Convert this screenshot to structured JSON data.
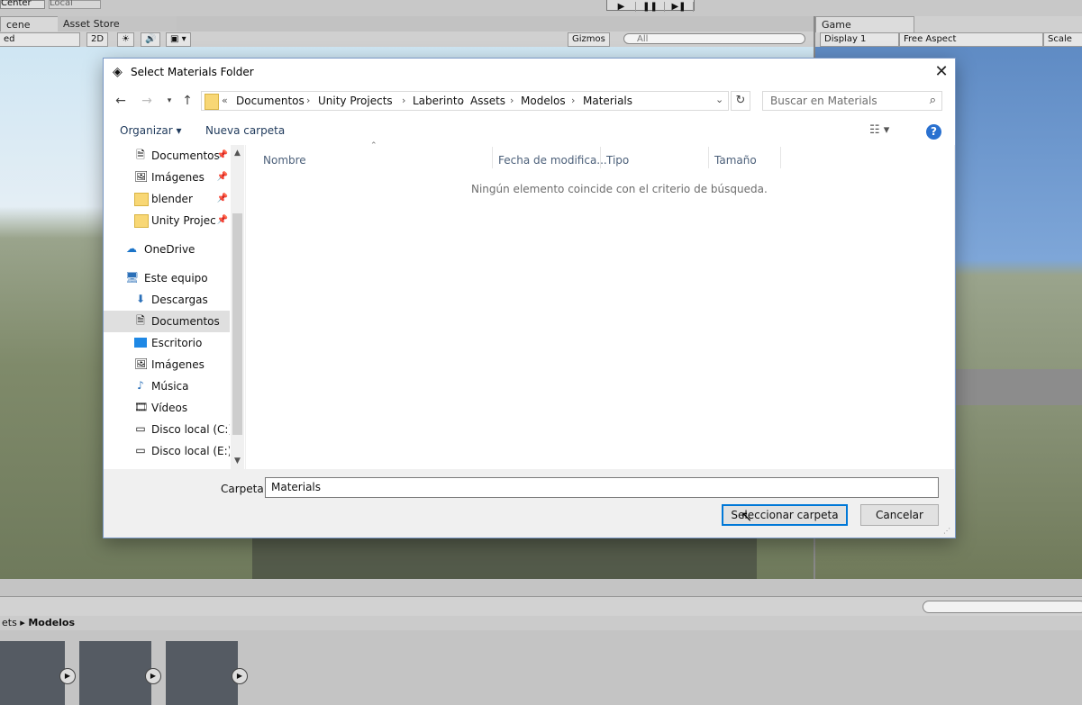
{
  "unity": {
    "top_buttons": {
      "center": "Center",
      "local": "Local"
    },
    "tabs": {
      "scene": "cene",
      "asset_store": "Asset Store",
      "game": "Game"
    },
    "scene_toolbar": {
      "shaded": "ed",
      "mode_2d": "2D",
      "gizmos": "Gizmos",
      "search_placeholder": "All"
    },
    "game_toolbar": {
      "display": "Display 1",
      "aspect": "Free Aspect",
      "scale": "Scale"
    },
    "play_controls": [
      "▶",
      "❚❚",
      "▶❚"
    ],
    "project_breadcrumb": {
      "parent": "ets",
      "current": "Modelos"
    }
  },
  "dialog": {
    "title": "Select Materials Folder",
    "address": [
      "Documentos",
      "Unity Projects",
      "Laberinto",
      "Assets",
      "Modelos",
      "Materials"
    ],
    "address_prefix": "«",
    "search_placeholder": "Buscar en Materials",
    "commands": {
      "organize": "Organizar ▾",
      "new_folder": "Nueva carpeta"
    },
    "nav_items": [
      {
        "label": "Documentos",
        "icon": "document-icon",
        "pinned": true
      },
      {
        "label": "Imágenes",
        "icon": "pictures-icon",
        "pinned": true
      },
      {
        "label": "blender",
        "icon": "folder-icon",
        "pinned": true
      },
      {
        "label": "Unity Projects",
        "icon": "folder-icon",
        "pinned": true
      },
      {
        "label": "OneDrive",
        "icon": "cloud-icon"
      },
      {
        "label": "Este equipo",
        "icon": "computer-icon"
      },
      {
        "label": "Descargas",
        "icon": "download-icon"
      },
      {
        "label": "Documentos",
        "icon": "document-icon",
        "selected": true
      },
      {
        "label": "Escritorio",
        "icon": "desktop-icon"
      },
      {
        "label": "Imágenes",
        "icon": "pictures-icon"
      },
      {
        "label": "Música",
        "icon": "music-icon"
      },
      {
        "label": "Vídeos",
        "icon": "video-icon"
      },
      {
        "label": "Disco local (C:)",
        "icon": "drive-icon"
      },
      {
        "label": "Disco local (E:)",
        "icon": "drive-icon"
      }
    ],
    "columns": [
      "Nombre",
      "Fecha de modifica...",
      "Tipo",
      "Tamaño"
    ],
    "empty_message": "Ningún elemento coincide con el criterio de búsqueda.",
    "folder_label": "Carpeta:",
    "folder_value": "Materials",
    "buttons": {
      "select": "Seleccionar carpeta",
      "cancel": "Cancelar"
    }
  }
}
